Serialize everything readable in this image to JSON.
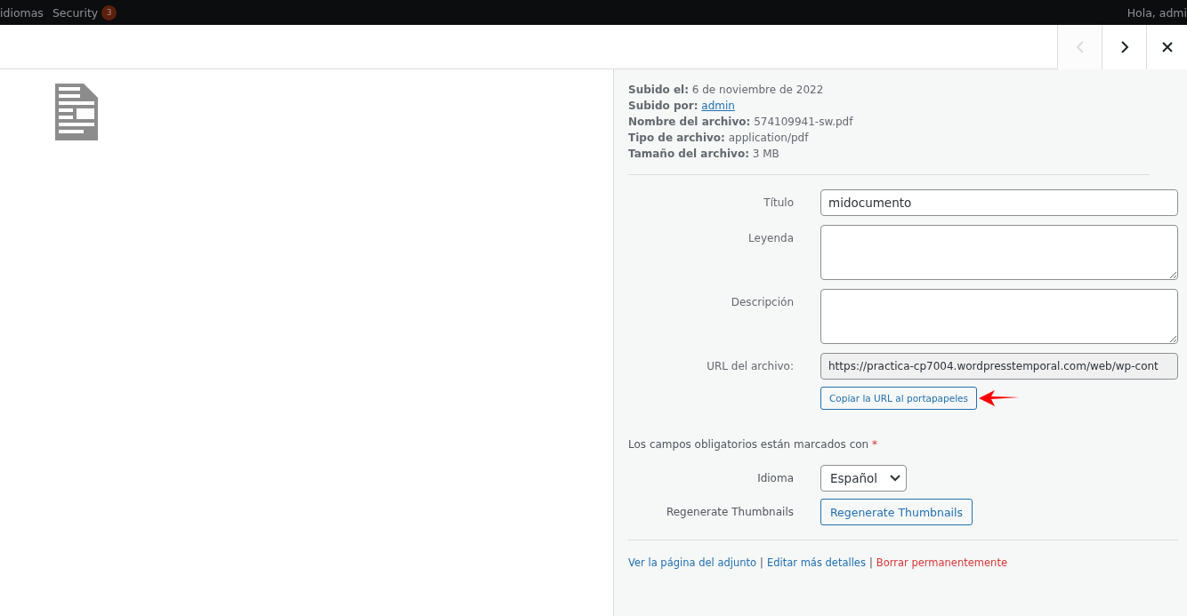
{
  "admin_bar": {
    "items": [
      {
        "label": "idiomas"
      },
      {
        "label": "Security",
        "badge": "3"
      }
    ],
    "greeting": "Hola, admi"
  },
  "modal": {
    "nav": [
      {
        "kind": "prev",
        "disabled": true
      },
      {
        "kind": "next",
        "disabled": false
      },
      {
        "kind": "close",
        "disabled": false
      }
    ]
  },
  "details": [
    {
      "label": "Subido el:",
      "value": "6 de noviembre de 2022",
      "link": false
    },
    {
      "label": "Subido por:",
      "value": "admin",
      "link": true
    },
    {
      "label": "Nombre del archivo:",
      "value": "574109941-sw.pdf",
      "link": false
    },
    {
      "label": "Tipo de archivo:",
      "value": "application/pdf",
      "link": false
    },
    {
      "label": "Tamaño del archivo:",
      "value": "3 MB",
      "link": false
    }
  ],
  "fields": [
    {
      "kind": "input",
      "label": "Título",
      "value": "midocumento"
    },
    {
      "kind": "textarea",
      "label": "Leyenda"
    },
    {
      "kind": "textarea",
      "label": "Descripción"
    },
    {
      "kind": "readonly",
      "label": "URL del archivo:",
      "value": "https://practica-cp7004.wordpresstemporal.com/web/wp-cont"
    }
  ],
  "copy_button": "Copiar la URL al portapapeles",
  "required_note": {
    "text": "Los campos obligatorios están marcados con",
    "mark": "*"
  },
  "settings": [
    {
      "kind": "select",
      "label": "Idioma",
      "value": "Español"
    },
    {
      "kind": "button",
      "label": "Regenerate Thumbnails",
      "value": "Regenerate Thumbnails"
    }
  ],
  "actions": [
    {
      "label": "Ver la página del adjunto",
      "danger": false
    },
    {
      "label": "Editar más detalles",
      "danger": false
    },
    {
      "label": "Borrar permanentemente",
      "danger": true
    }
  ],
  "separator": "|"
}
